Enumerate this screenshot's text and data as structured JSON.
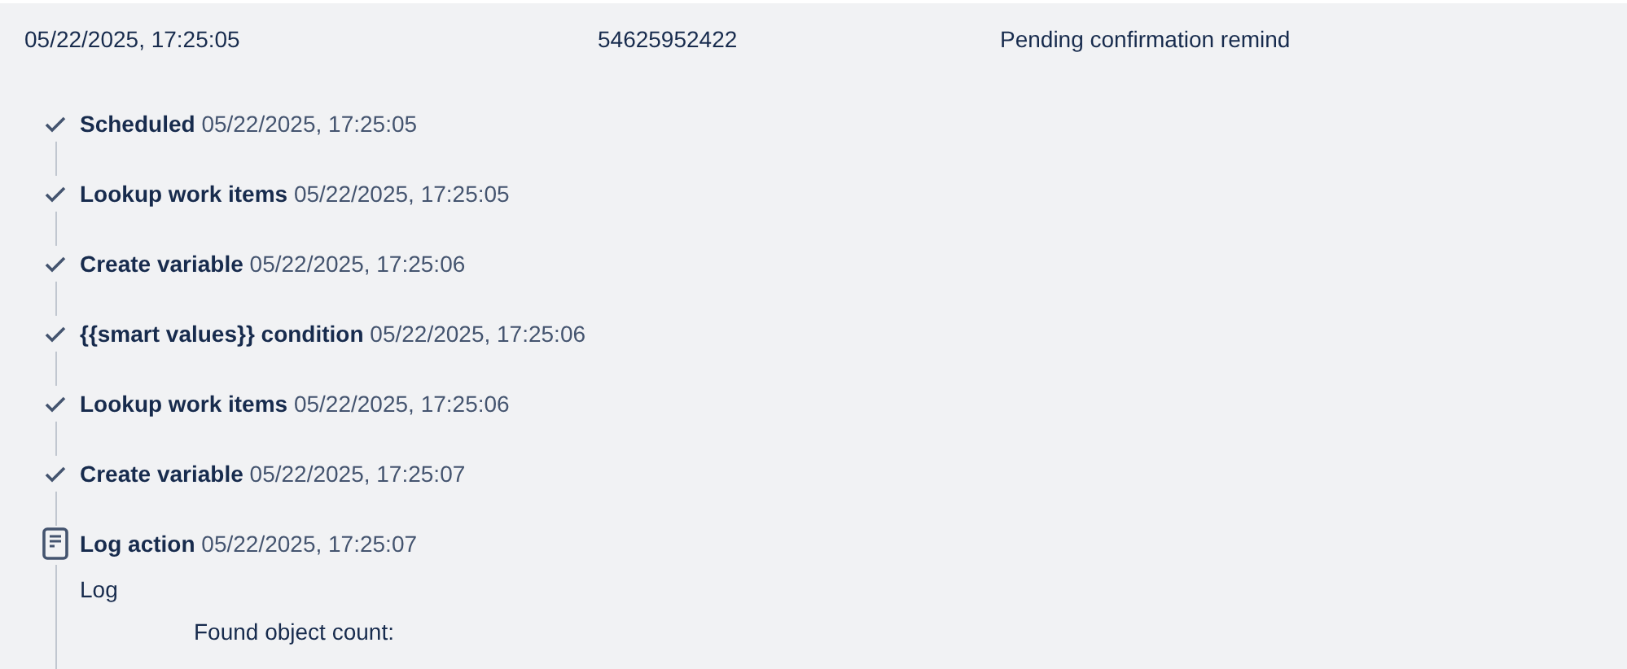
{
  "header": {
    "time": "05/22/2025, 17:25:05",
    "id": "54625952422",
    "rule": "Pending confirmation remind"
  },
  "steps": [
    {
      "kind": "check",
      "name": "Scheduled",
      "time": "05/22/2025, 17:25:05"
    },
    {
      "kind": "check",
      "name": "Lookup work items",
      "time": "05/22/2025, 17:25:05"
    },
    {
      "kind": "check",
      "name": "Create variable",
      "time": "05/22/2025, 17:25:06"
    },
    {
      "kind": "check",
      "name": "{{smart values}} condition",
      "time": "05/22/2025, 17:25:06"
    },
    {
      "kind": "check",
      "name": "Lookup work items",
      "time": "05/22/2025, 17:25:06"
    },
    {
      "kind": "check",
      "name": "Create variable",
      "time": "05/22/2025, 17:25:07"
    },
    {
      "kind": "log",
      "name": "Log action",
      "time": "05/22/2025, 17:25:07",
      "label": "Log",
      "message": "Found object count:"
    }
  ]
}
